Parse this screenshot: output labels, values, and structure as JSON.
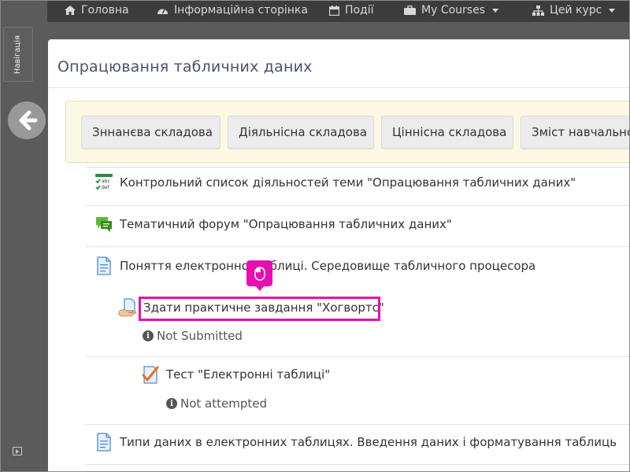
{
  "topnav": {
    "items": [
      {
        "label": "Головна",
        "icon": "home-icon"
      },
      {
        "label": "Інформаційна сторінка",
        "icon": "dashboard-icon"
      },
      {
        "label": "Події",
        "icon": "calendar-icon"
      },
      {
        "label": "My Courses",
        "icon": "briefcase-icon"
      },
      {
        "label": "Цей курс",
        "icon": "sitemap-icon"
      }
    ]
  },
  "sidebar": {
    "nav_tab_label": "Навігація"
  },
  "page": {
    "title": "Опрацювання табличних даних"
  },
  "tabs": [
    {
      "label": "Зннанєва складова"
    },
    {
      "label": "Діяльнісна складова"
    },
    {
      "label": "Ціннісна складова"
    },
    {
      "label": "Зміст навчального"
    }
  ],
  "activities": [
    {
      "label": "Контрольний список діяльностей теми \"Опрацювання табличних даних\"",
      "icon": "checklist-icon"
    },
    {
      "label": "Тематичний форум \"Опрацювання табличних даних\"",
      "icon": "forum-icon"
    },
    {
      "label": "Поняття електронної таблиці. Середовище табличного процесора",
      "icon": "page-icon"
    },
    {
      "label": "Здати практичне завдання \"Хогвортс\"",
      "icon": "assignment-icon",
      "status": "Not Submitted"
    },
    {
      "label": "Тест \"Електронні таблиці\"",
      "icon": "quiz-icon",
      "status": "Not attempted"
    },
    {
      "label": "Типи даних в електронних таблицях. Введення даних і форматування таблиць",
      "icon": "page-icon"
    }
  ],
  "colors": {
    "highlight": "#e60fb0",
    "title": "#4a5070",
    "tabs_box_bg": "#fcf8e3"
  }
}
